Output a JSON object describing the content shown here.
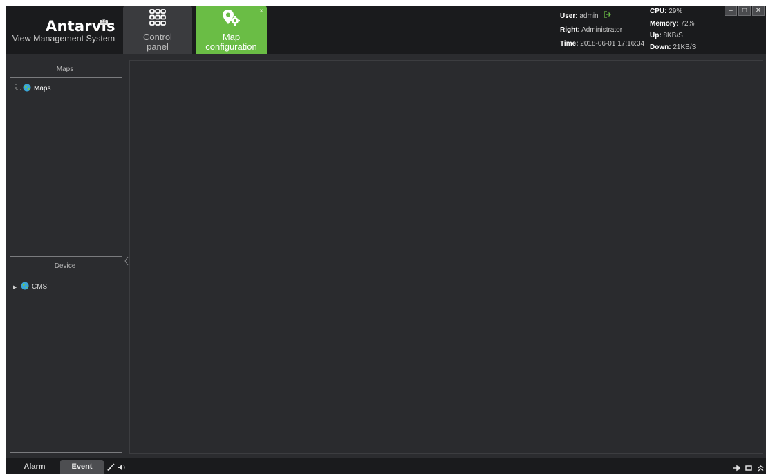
{
  "app": {
    "logo_title": "Antarvis",
    "logo_badge": "2.0",
    "logo_subtitle": "View Management System"
  },
  "tabs": [
    {
      "label_line1": "Control",
      "label_line2": "panel",
      "icon": "grid-icon"
    },
    {
      "label_line1": "Map",
      "label_line2": "configuration",
      "icon": "map-gear-icon",
      "close": "×"
    }
  ],
  "status": {
    "user_label": "User:",
    "user_value": "admin",
    "right_label": "Right:",
    "right_value": "Administrator",
    "time_label": "Time:",
    "time_value": "2018-06-01 17:16:34",
    "cpu_label": "CPU:",
    "cpu_value": "29%",
    "memory_label": "Memory:",
    "memory_value": "72%",
    "up_label": "Up:",
    "up_value": "8KB/S",
    "down_label": "Down:",
    "down_value": "21KB/S"
  },
  "window_controls": {
    "minimize": "–",
    "maximize": "□",
    "close": "✕"
  },
  "left_panel": {
    "maps_title": "Maps",
    "maps_tree": [
      {
        "label": "Maps",
        "icon": "globe-icon"
      }
    ],
    "device_title": "Device",
    "device_tree": [
      {
        "label": "CMS",
        "icon": "globe-icon",
        "expander": "▶"
      }
    ]
  },
  "footer": {
    "alarm_label": "Alarm",
    "event_label": "Event"
  },
  "colors": {
    "accent": "#6abd45",
    "background": "#2b2c2f",
    "header": "#1a1b1d"
  }
}
